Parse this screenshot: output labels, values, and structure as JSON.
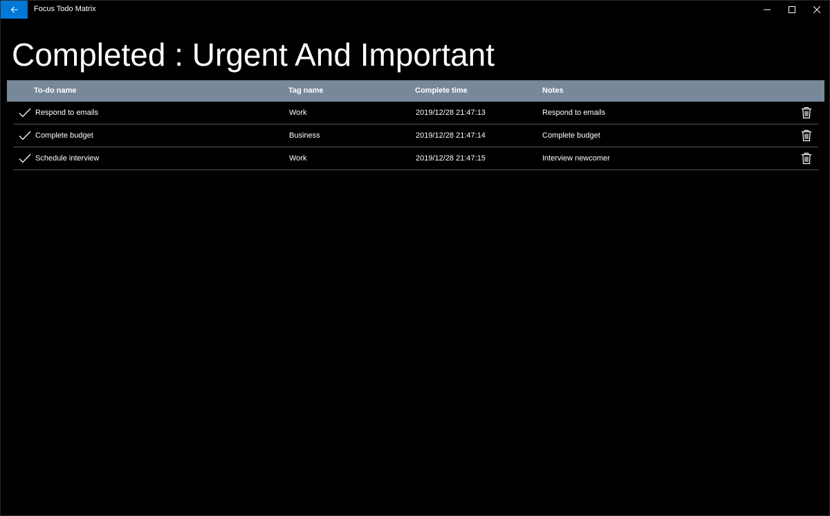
{
  "window": {
    "title": "Focus Todo Matrix"
  },
  "page": {
    "title": "Completed : Urgent And Important"
  },
  "table": {
    "headers": {
      "todo_name": "To-do name",
      "tag_name": "Tag name",
      "complete_time": "Complete time",
      "notes": "Notes"
    },
    "rows": [
      {
        "todo_name": "Respond to emails",
        "tag_name": "Work",
        "complete_time": "2019/12/28 21:47:13",
        "notes": "Respond to emails"
      },
      {
        "todo_name": "Complete budget",
        "tag_name": "Business",
        "complete_time": "2019/12/28 21:47:14",
        "notes": "Complete budget"
      },
      {
        "todo_name": "Schedule interview",
        "tag_name": "Work",
        "complete_time": "2019/12/28 21:47:15",
        "notes": "Interview newcomer"
      }
    ]
  },
  "icons": {
    "back": "arrow-left-icon",
    "minimize": "minimize-icon",
    "maximize": "maximize-icon",
    "close": "close-icon",
    "completed": "checkmark-icon",
    "delete": "trash-icon"
  },
  "colors": {
    "accent": "#0078d7",
    "header_background": "#778899",
    "background": "#000000",
    "text": "#ffffff"
  }
}
